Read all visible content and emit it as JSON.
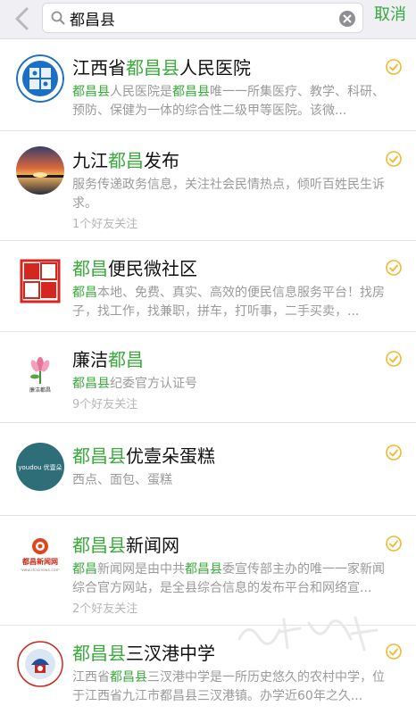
{
  "search": {
    "query": "都昌县",
    "cancel_label": "取消"
  },
  "results": [
    {
      "title_parts": [
        "江西省",
        "都昌县",
        "人民医院"
      ],
      "desc_parts": [
        "都昌县",
        "人民医院是",
        "都昌县",
        "唯一一所集医疗、教学、科研、预防、保健为一体的综合性二级甲等医院。该微..."
      ],
      "friends": ""
    },
    {
      "title_parts": [
        "九江",
        "都昌",
        "发布"
      ],
      "desc_parts": [
        "",
        "服务传递政务信息，关注社会民情热点，倾听百姓民生诉求。",
        "",
        ""
      ],
      "friends": "1个好友关注"
    },
    {
      "title_parts": [
        "",
        "都昌",
        "便民微社区"
      ],
      "desc_parts": [
        "都昌",
        "本地、免费、真实、高效的便民信息服务平台！找房子，找工作，找兼职，拼车，打听事，二手买卖，...",
        "",
        ""
      ],
      "friends": ""
    },
    {
      "title_parts": [
        "廉洁",
        "都昌",
        ""
      ],
      "desc_parts": [
        "都昌县",
        "纪委官方认证号",
        "",
        ""
      ],
      "friends": "9个好友关注"
    },
    {
      "title_parts": [
        "",
        "都昌县",
        "优壹朵蛋糕"
      ],
      "desc_parts": [
        "",
        "西点、面包、蛋糕",
        "",
        ""
      ],
      "friends": ""
    },
    {
      "title_parts": [
        "",
        "都昌县",
        "新闻网"
      ],
      "desc_parts": [
        "都昌",
        "新闻网是由中共",
        "都昌县",
        "委宣传部主办的唯一一家新闻综合官方网站，是全县综合信息的发布平台和网络宣..."
      ],
      "friends": "2个好友关注"
    },
    {
      "title_parts": [
        "",
        "都昌县",
        "三汊港中学"
      ],
      "desc_parts": [
        "江西省",
        "都昌县",
        "三汊港中学是一所历史悠久的农村中学，位于江西省九江市",
        "都昌县三汊港镇。办学近60年之久..."
      ],
      "friends": ""
    }
  ],
  "logo_text": {
    "lianjie_caption": "廉洁都昌",
    "cake_logo_text": "youdou 优壹朵",
    "news_logo_text": "都昌新闻网",
    "news_logo_url": "www.dcxinews.com"
  },
  "colors": {
    "accent_green": "#3bab3c",
    "verified_gold": "#f0b82d"
  }
}
